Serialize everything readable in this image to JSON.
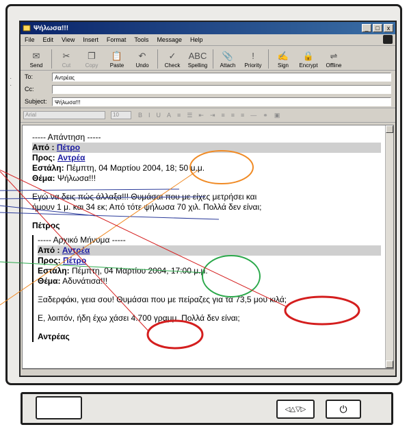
{
  "window": {
    "title": "Ψήλωσα!!!",
    "controls": [
      "_",
      "□",
      "x"
    ]
  },
  "menu": [
    "File",
    "Edit",
    "View",
    "Insert",
    "Format",
    "Tools",
    "Message",
    "Help"
  ],
  "toolbar": [
    {
      "label": "Send",
      "icon": "send-icon",
      "glyph": "✉",
      "disabled": false
    },
    {
      "label": "Cut",
      "icon": "cut-icon",
      "glyph": "✂",
      "disabled": true
    },
    {
      "label": "Copy",
      "icon": "copy-icon",
      "glyph": "❐",
      "disabled": true
    },
    {
      "label": "Paste",
      "icon": "paste-icon",
      "glyph": "📋",
      "disabled": false
    },
    {
      "label": "Undo",
      "icon": "undo-icon",
      "glyph": "↶",
      "disabled": false
    },
    {
      "label": "Check",
      "icon": "check-icon",
      "glyph": "✓",
      "disabled": false
    },
    {
      "label": "Spelling",
      "icon": "spelling-icon",
      "glyph": "ABC",
      "disabled": false
    },
    {
      "label": "Attach",
      "icon": "attach-icon",
      "glyph": "📎",
      "disabled": false
    },
    {
      "label": "Priority",
      "icon": "priority-icon",
      "glyph": "!",
      "disabled": false
    },
    {
      "label": "Sign",
      "icon": "sign-icon",
      "glyph": "✍",
      "disabled": false
    },
    {
      "label": "Encrypt",
      "icon": "encrypt-icon",
      "glyph": "🔒",
      "disabled": false
    },
    {
      "label": "Offline",
      "icon": "offline-icon",
      "glyph": "⇌",
      "disabled": false
    }
  ],
  "header": {
    "to_label": "To:",
    "to_value": "Αντρέας",
    "cc_label": "Cc:",
    "cc_value": "",
    "subject_label": "Subject:",
    "subject_value": "Ψήλωσα!!!"
  },
  "formatting": {
    "font": "Arial",
    "size": "10"
  },
  "reply": {
    "separator": "----- Απάντηση -----",
    "from_label": "Από :",
    "from_value": "Πέτρο",
    "to_label": "Προς:",
    "to_value": "Αντρέα",
    "sent_label": "Εστάλη:",
    "sent_value": "Πέμπτη, 04 Μαρτίου 2004, 18; 50 μ.μ.",
    "subject_label": "Θέμα:",
    "subject_value": "Ψήλωσα!!!",
    "body_line1": "Εγώ να δεις πώς άλλαξα!!! Θυμάσαι που με είχες μετρήσει και",
    "body_line2": "ήμουν 1 μ. και 34 εκ; Από τότε ψήλωσα 70 χιλ. Πολλά δεν είναι;",
    "signature": "Πέτρος"
  },
  "original": {
    "separator": "----- Αρχικό Μήνυμα -----",
    "from_label": "Από :",
    "from_value": "Αντρέα",
    "to_label": "Προς:",
    "to_value": "Πέτρο",
    "sent_label": "Εστάλη:",
    "sent_value": "Πέμπτη, 04 Μαρτίου 2004, 17:00 μ.μ.",
    "subject_label": "Θέμα:",
    "subject_value": "Αδυνάτισα!!!",
    "body_line1": "Ξαδερφάκι, γεια σου!  Θυμάσαι που με πείραζες για τα 73,5 μου κιλά;",
    "body_line2": "Ε, λοιπόν, ήδη έχω χάσει 4.700 γραμμ. Πολλά δεν είναι;",
    "signature": "Αντρέας"
  },
  "annotations": {
    "orange": "#f08a24",
    "green": "#2aa84a",
    "red": "#d41e1e",
    "blue": "#2a3a9a"
  }
}
